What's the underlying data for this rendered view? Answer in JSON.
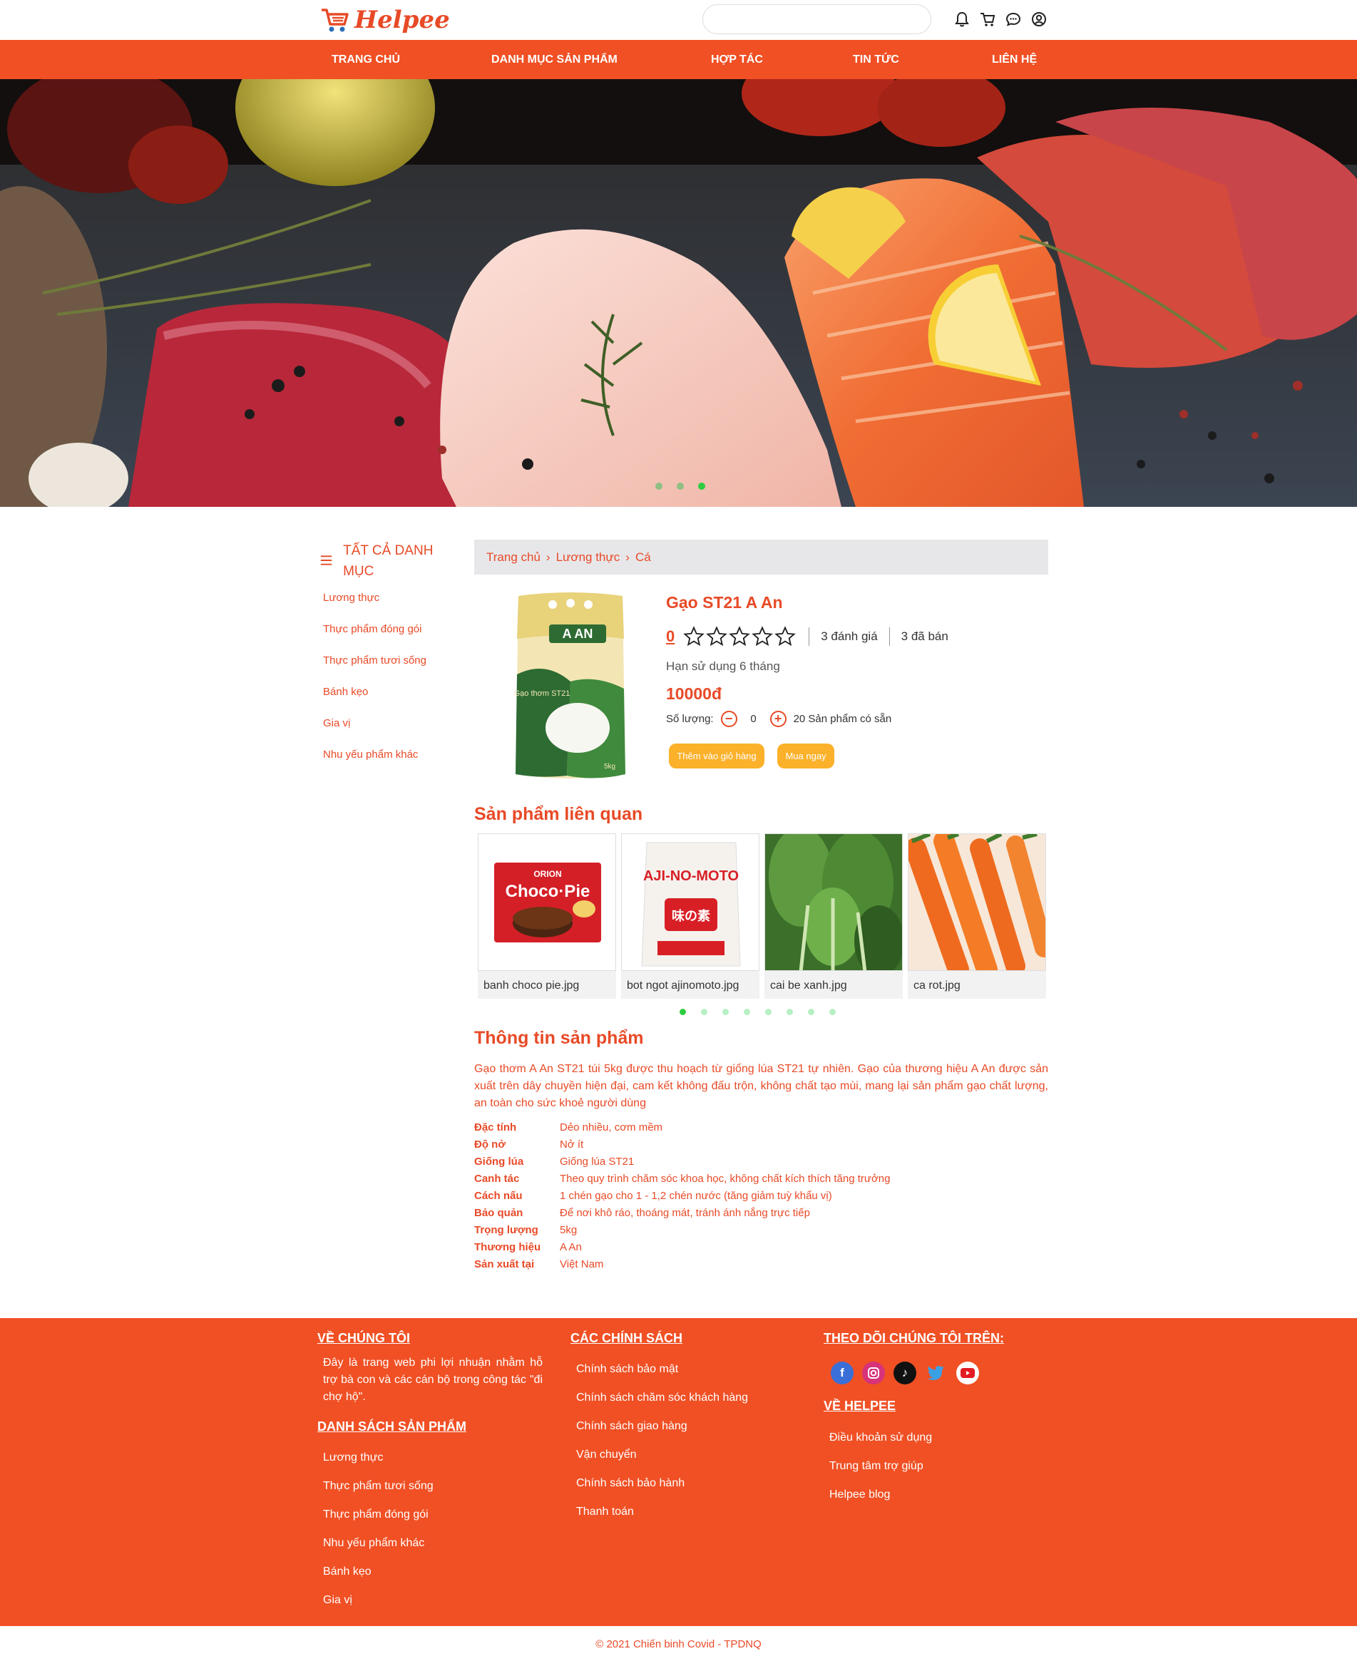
{
  "header": {
    "logo_text": "Helpee",
    "search": {
      "value": "",
      "placeholder": ""
    },
    "icons": [
      "bell-icon",
      "cart-icon",
      "chat-icon",
      "user-icon"
    ]
  },
  "nav": [
    "TRANG CHỦ",
    "DANH MỤC SẢN PHẨM",
    "HỢP TÁC",
    "TIN TỨC",
    "LIÊN HỆ"
  ],
  "banner": {
    "active_slide": 3,
    "slide_count": 3
  },
  "sidebar": {
    "title": "TẤT CẢ DANH MỤC",
    "items": [
      "Lương thực",
      "Thực phẩm đóng gói",
      "Thực phẩm tươi sống",
      "Bánh kẹo",
      "Gia vị",
      "Nhu yếu phẩm khác"
    ]
  },
  "breadcrumb": [
    "Trang chủ",
    "Lương thực",
    "Cá"
  ],
  "product": {
    "name": "Gạo ST21 A An",
    "rating": "0",
    "stars_filled": 0,
    "reviews": "3 đánh giá",
    "sold": "3 đã bán",
    "expiry": "Hạn sử dụng 6 tháng",
    "price": "10000đ",
    "qty_label": "Số lượng:",
    "qty_value": "0",
    "stock": "20 Sản phẩm có sẵn",
    "add_cart": "Thêm vào giỏ hàng",
    "buy_now": "Mua ngay",
    "package_brand": "A AN",
    "package_label": "Gạo thơm ST21",
    "package_weight": "5kg"
  },
  "related": {
    "title": "Sản phẩm liên quan",
    "items": [
      "banh choco pie.jpg",
      "bot ngot ajinomoto.jpg",
      "cai be xanh.jpg",
      "ca rot.jpg"
    ],
    "logos": {
      "choco_brand": "ORION",
      "choco_name": "Choco·Pie",
      "aji_name": "AJI-NO-MOTO",
      "aji_kanji": "味の素"
    },
    "active_page": 1,
    "page_count": 8
  },
  "info": {
    "title": "Thông tin sản phẩm",
    "description": "Gạo thơm A An ST21 túi 5kg được thu hoạch từ giống lúa ST21 tự nhiên. Gạo của thương hiệu A An được sản xuất trên dây chuyền hiện đại, cam kết không đấu trộn, không chất tạo mùi, mang lại sản phẩm gạo chất lượng, an toàn cho sức khoẻ người dùng",
    "specs": [
      {
        "k": "Đặc tính",
        "v": "Dẻo nhiều, cơm mềm"
      },
      {
        "k": "Độ nở",
        "v": "Nở ít"
      },
      {
        "k": "Giống lúa",
        "v": "Giống lúa ST21"
      },
      {
        "k": "Canh tác",
        "v": "Theo quy trình chăm sóc khoa học, không chất kích thích tăng trưởng"
      },
      {
        "k": "Cách nấu",
        "v": "1 chén gạo cho 1 - 1,2 chén nước (tăng giảm tuỳ khẩu vị)"
      },
      {
        "k": "Bảo quản",
        "v": "Để nơi khô ráo, thoáng mát, tránh ánh nắng trực tiếp"
      },
      {
        "k": "Trọng lượng",
        "v": "5kg"
      },
      {
        "k": "Thương hiệu",
        "v": "A An"
      },
      {
        "k": "Sản xuất tại",
        "v": "Việt Nam"
      }
    ]
  },
  "footer": {
    "about_title": "VỀ CHÚNG TÔI",
    "about_text": "Đây là trang web phi lợi nhuận nhằm hỗ trợ bà con và các cán bộ trong công tác \"đi chợ hộ\".",
    "products_title": "DANH SÁCH SẢN PHẨM",
    "products": [
      "Lương thực",
      "Thực phẩm tươi sống",
      "Thực phẩm đóng gói",
      "Nhu yếu phẩm khác",
      "Bánh kẹo",
      "Gia vị"
    ],
    "policies_title": "CÁC CHÍNH SÁCH",
    "policies": [
      "Chính sách bảo mật",
      "Chính sách chăm sóc khách hàng",
      "Chính sách giao hàng",
      "Vận chuyển",
      "Chính sách bảo hành",
      "Thanh toán"
    ],
    "follow_title": "THEO DÕI CHÚNG TÔI TRÊN:",
    "social": [
      "facebook-icon",
      "instagram-icon",
      "tiktok-icon",
      "twitter-icon",
      "youtube-icon"
    ],
    "helpee_title": "VỀ HELPEE",
    "helpee": [
      "Điều khoản sử dụng",
      "Trung tâm trợ giúp",
      "Helpee blog"
    ],
    "copyright": "© 2021 Chiến binh Covid - TPDNQ"
  },
  "colors": {
    "brand": "#f05024",
    "text_accent": "#e84a27",
    "button": "#fbb12a",
    "dot_active": "#2ecc40"
  }
}
